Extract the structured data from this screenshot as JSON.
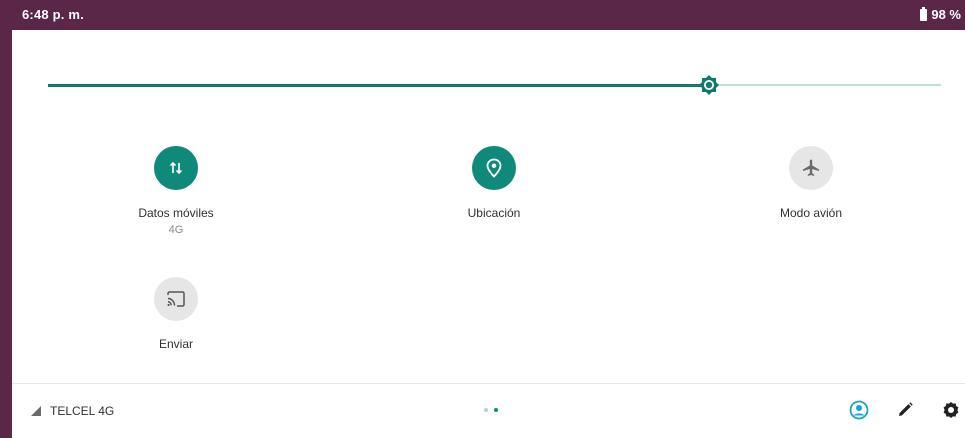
{
  "status_bar": {
    "time": "6:48 p. m.",
    "battery": "98 %"
  },
  "brightness": {
    "level": 0.74
  },
  "tiles": [
    {
      "label": "Datos móviles",
      "sublabel": "4G",
      "state": "on",
      "icon": "mobile-data-icon"
    },
    {
      "label": "Ubicación",
      "sublabel": "",
      "state": "on",
      "icon": "location-icon"
    },
    {
      "label": "Modo avión",
      "sublabel": "",
      "state": "off",
      "icon": "airplane-icon"
    },
    {
      "label": "Enviar",
      "sublabel": "",
      "state": "off",
      "icon": "cast-icon"
    }
  ],
  "footer": {
    "carrier": "TELCEL 4G",
    "page_dots": 2,
    "active_page": 2,
    "icons": [
      "user-icon",
      "edit-icon",
      "settings-icon"
    ]
  },
  "colors": {
    "accent": "#0f8a7a",
    "status_bar": "#5a2748",
    "tile_off": "#e6e6e6",
    "user_icon": "#13a6c8"
  }
}
